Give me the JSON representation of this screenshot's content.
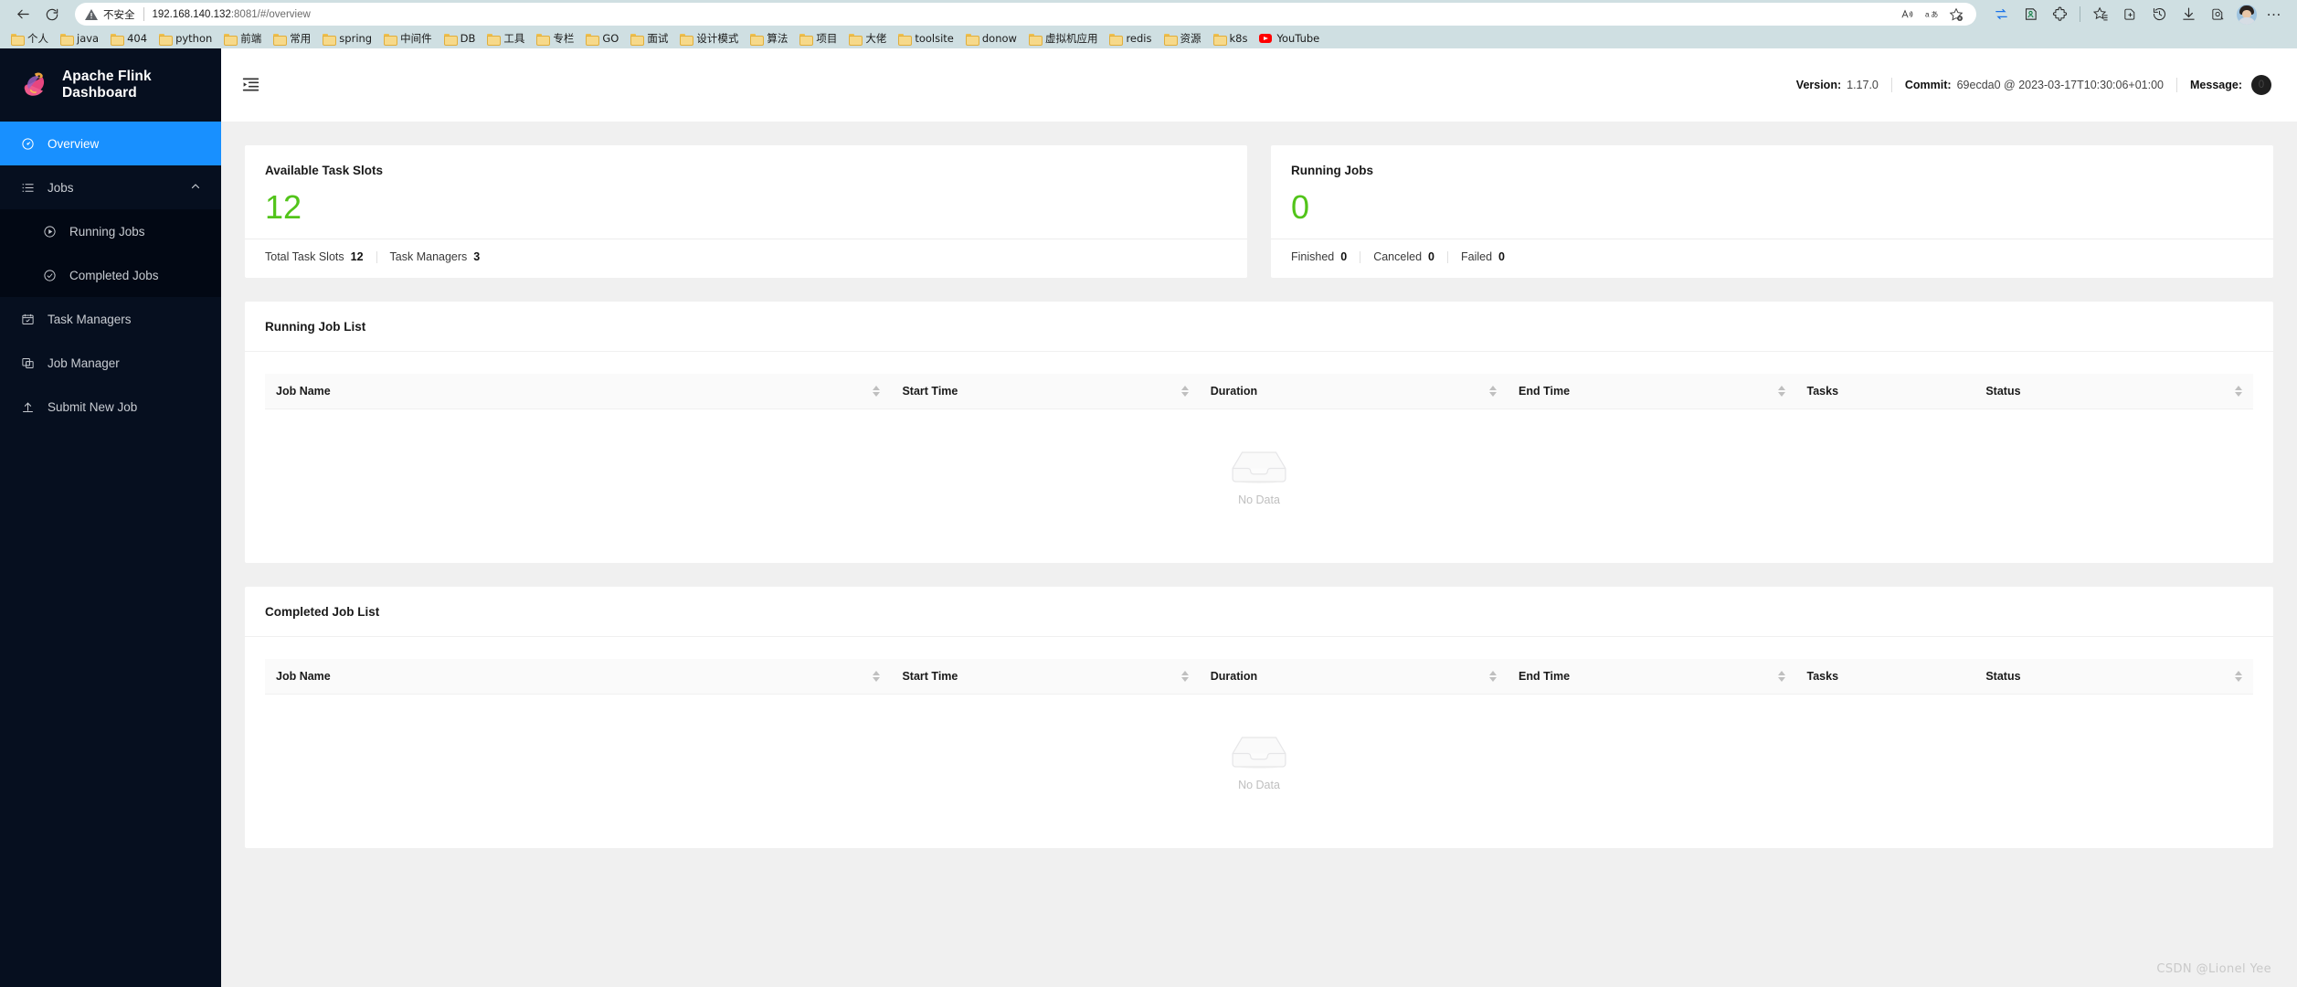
{
  "browser": {
    "back_icon": "back-arrow-icon",
    "reload_icon": "reload-icon",
    "security_label": "不安全",
    "url_host": "192.168.140.132",
    "url_rest": ":8081/#/overview",
    "omni_actions": [
      "read-aloud-icon",
      "translate-icon",
      "add-favorite-icon"
    ],
    "toolbar_icons": [
      "split-screen-icon",
      "copilot-icon",
      "extensions-icon",
      "collections-icon",
      "browser-essentials-icon",
      "history-icon",
      "downloads-icon",
      "screenshot-icon"
    ],
    "profile_label": "profile-avatar",
    "more_label": "…",
    "bookmarks": [
      {
        "label": "个人",
        "icon": "folder"
      },
      {
        "label": "java",
        "icon": "folder"
      },
      {
        "label": "404",
        "icon": "folder"
      },
      {
        "label": "python",
        "icon": "folder"
      },
      {
        "label": "前端",
        "icon": "folder"
      },
      {
        "label": "常用",
        "icon": "folder"
      },
      {
        "label": "spring",
        "icon": "folder"
      },
      {
        "label": "中间件",
        "icon": "folder"
      },
      {
        "label": "DB",
        "icon": "folder"
      },
      {
        "label": "工具",
        "icon": "folder"
      },
      {
        "label": "专栏",
        "icon": "folder"
      },
      {
        "label": "GO",
        "icon": "folder"
      },
      {
        "label": "面试",
        "icon": "folder"
      },
      {
        "label": "设计模式",
        "icon": "folder"
      },
      {
        "label": "算法",
        "icon": "folder"
      },
      {
        "label": "项目",
        "icon": "folder"
      },
      {
        "label": "大佬",
        "icon": "folder"
      },
      {
        "label": "toolsite",
        "icon": "folder"
      },
      {
        "label": "donow",
        "icon": "folder"
      },
      {
        "label": "虚拟机应用",
        "icon": "folder"
      },
      {
        "label": "redis",
        "icon": "folder"
      },
      {
        "label": "资源",
        "icon": "folder"
      },
      {
        "label": "k8s",
        "icon": "folder"
      },
      {
        "label": "YouTube",
        "icon": "youtube"
      }
    ]
  },
  "sidebar": {
    "brand": "Apache Flink Dashboard",
    "items": [
      {
        "label": "Overview",
        "icon": "dashboard-icon",
        "active": true
      },
      {
        "label": "Jobs",
        "icon": "list-icon",
        "expanded": true
      },
      {
        "label": "Running Jobs",
        "icon": "play-circle-icon",
        "sub": true
      },
      {
        "label": "Completed Jobs",
        "icon": "check-circle-icon",
        "sub": true
      },
      {
        "label": "Task Managers",
        "icon": "task-manager-icon"
      },
      {
        "label": "Job Manager",
        "icon": "job-manager-icon"
      },
      {
        "label": "Submit New Job",
        "icon": "upload-icon"
      }
    ]
  },
  "topbar": {
    "fold_icon": "menu-fold-icon",
    "version_label": "Version:",
    "version_value": "1.17.0",
    "commit_label": "Commit:",
    "commit_value": "69ecda0 @ 2023-03-17T10:30:06+01:00",
    "message_label": "Message:",
    "message_count": "0"
  },
  "cards": [
    {
      "title": "Available Task Slots",
      "value": "12",
      "value_color": "#52c41a",
      "stats": [
        {
          "label": "Total Task Slots",
          "value": "12"
        },
        {
          "label": "Task Managers",
          "value": "3"
        }
      ]
    },
    {
      "title": "Running Jobs",
      "value": "0",
      "value_color": "#52c41a",
      "stats": [
        {
          "label": "Finished",
          "value": "0"
        },
        {
          "label": "Canceled",
          "value": "0"
        },
        {
          "label": "Failed",
          "value": "0"
        }
      ]
    }
  ],
  "running_panel": {
    "title": "Running Job List",
    "columns": [
      "Job Name",
      "Start Time",
      "Duration",
      "End Time",
      "Tasks",
      "Status"
    ],
    "rows": [],
    "empty_text": "No Data"
  },
  "completed_panel": {
    "title": "Completed Job List",
    "columns": [
      "Job Name",
      "Start Time",
      "Duration",
      "End Time",
      "Tasks",
      "Status"
    ],
    "rows": [],
    "empty_text": "No Data"
  },
  "watermark": "CSDN @Lionel Yee"
}
